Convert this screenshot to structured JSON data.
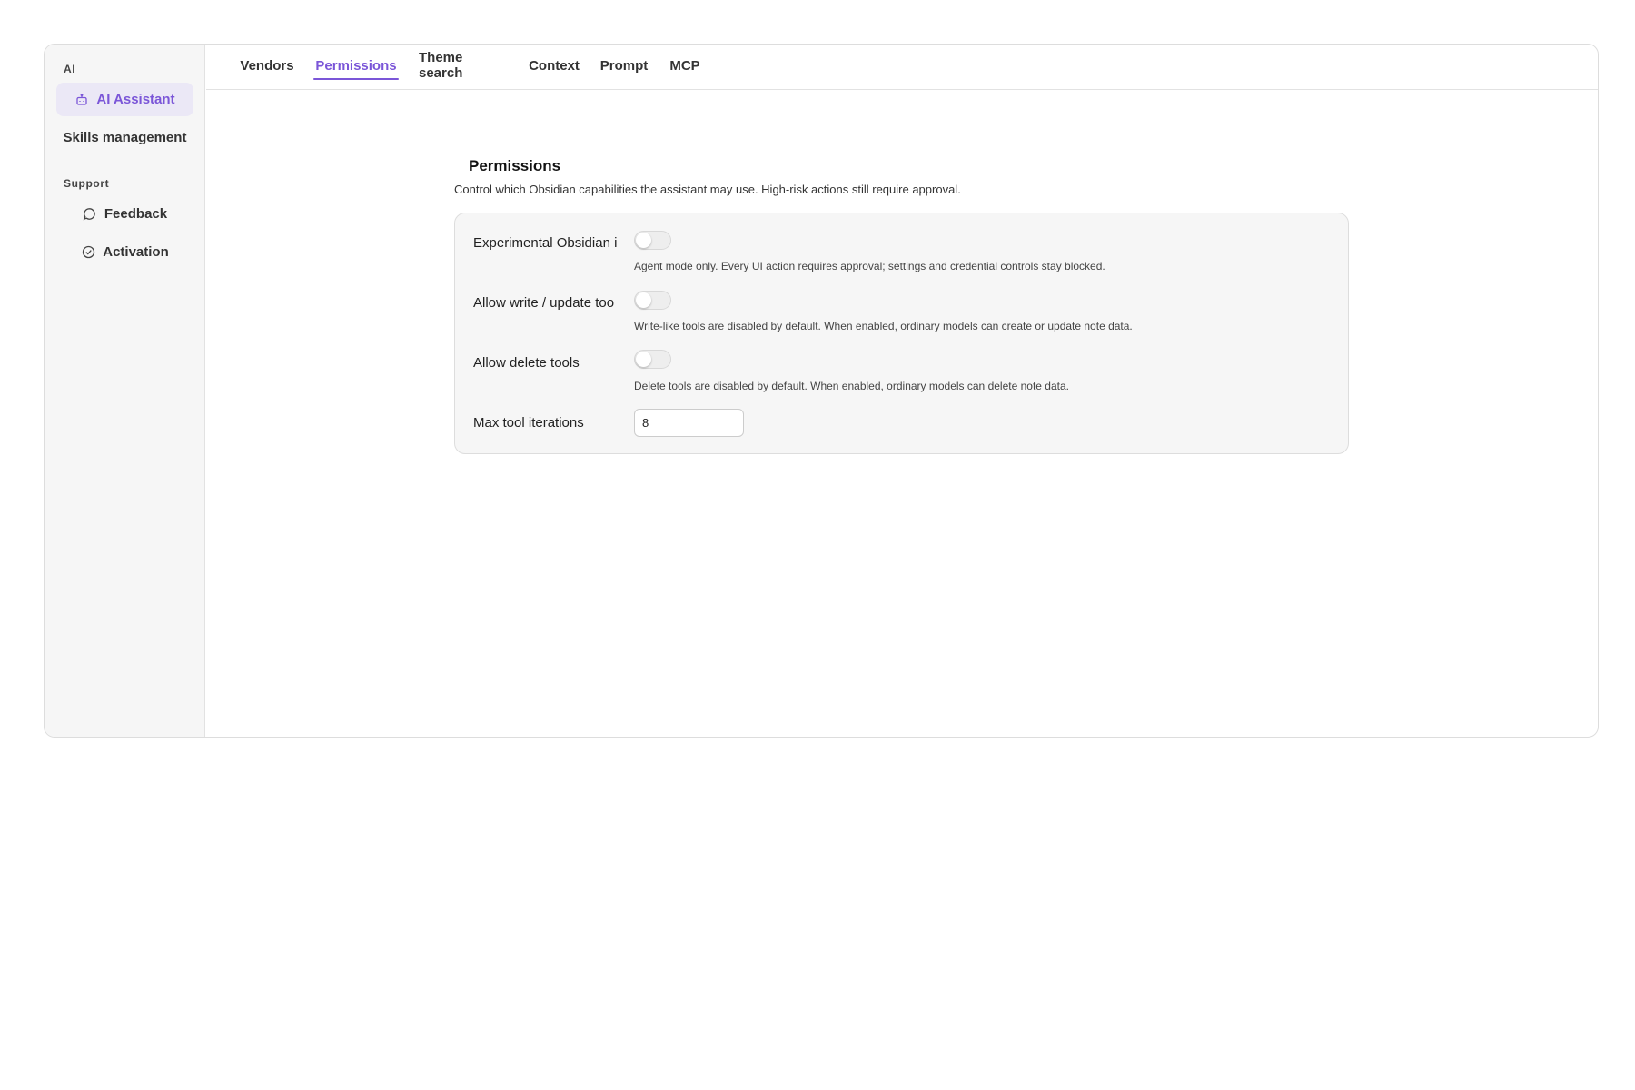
{
  "sidebar": {
    "sections": [
      {
        "label": "AI",
        "items": [
          {
            "label": "AI Assistant",
            "icon": "robot-icon",
            "active": true
          },
          {
            "label": "Skills management",
            "icon": null,
            "active": false
          }
        ]
      },
      {
        "label": "Support",
        "items": [
          {
            "label": "Feedback",
            "icon": "chat-bubble-icon",
            "active": false
          },
          {
            "label": "Activation",
            "icon": "check-circle-icon",
            "active": false
          }
        ]
      }
    ]
  },
  "tabs": [
    {
      "label": "Vendors",
      "active": false
    },
    {
      "label": "Permissions",
      "active": true
    },
    {
      "label": "Theme search",
      "active": false
    },
    {
      "label": "Context",
      "active": false
    },
    {
      "label": "Prompt",
      "active": false
    },
    {
      "label": "MCP",
      "active": false
    }
  ],
  "content": {
    "title": "Permissions",
    "description": "Control which Obsidian capabilities the assistant may use. High-risk actions still require approval.",
    "settings": [
      {
        "label": "Experimental Obsidian i",
        "enabled": false,
        "description": "Agent mode only. Every UI action requires approval; settings and credential controls stay blocked."
      },
      {
        "label": "Allow write / update too",
        "enabled": false,
        "description": "Write-like tools are disabled by default. When enabled, ordinary models can create or update note data."
      },
      {
        "label": "Allow delete tools",
        "enabled": false,
        "description": "Delete tools are disabled by default. When enabled, ordinary models can delete note data."
      }
    ],
    "max_iterations": {
      "label": "Max tool iterations",
      "value": "8"
    }
  },
  "colors": {
    "accent": "#7b56d8",
    "active_nav_bg": "#ebe8f6",
    "sidebar_bg": "#f6f6f6",
    "card_bg": "#f6f6f6"
  }
}
